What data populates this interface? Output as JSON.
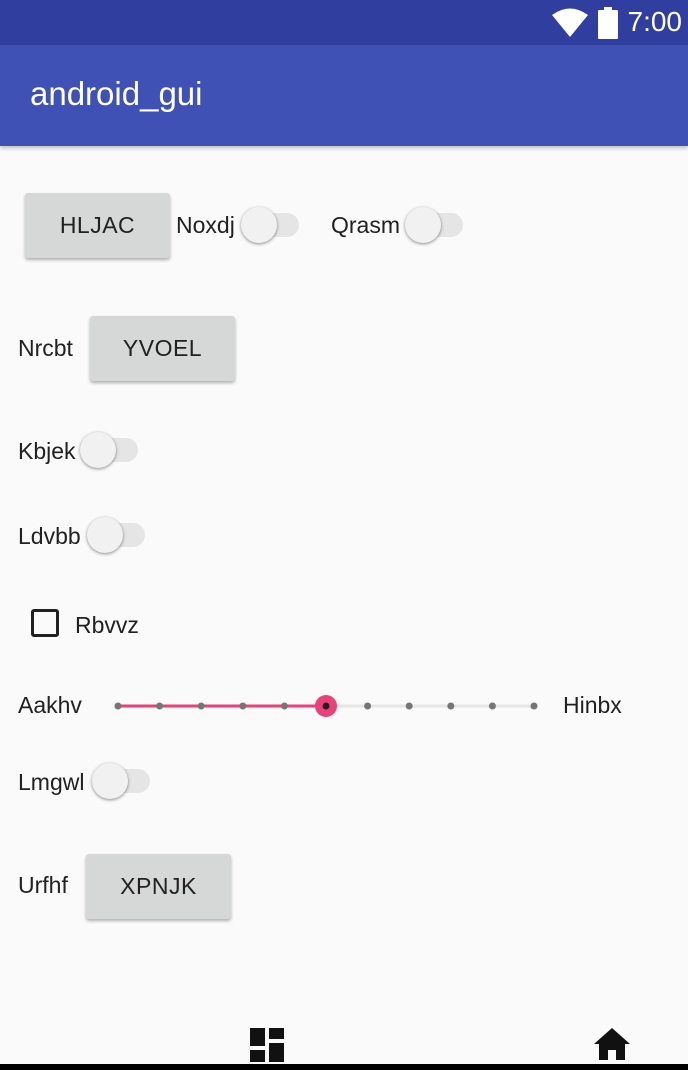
{
  "status_bar": {
    "time": "7:00",
    "wifi_icon": "wifi-icon",
    "battery_icon": "battery-icon"
  },
  "app_bar": {
    "title": "android_gui"
  },
  "controls": {
    "button_1": "HLJAC",
    "switch_1_label": "Noxdj",
    "switch_2_label": "Qrasm",
    "button_2_label": "Nrcbt",
    "button_2": "YVOEL",
    "switch_3_label": "Kbjek",
    "switch_4_label": "Ldvbb",
    "checkbox_label": "Rbvvz",
    "slider_min_label": "Aakhv",
    "slider_max_label": "Hinbx",
    "switch_5_label": "Lmgwl",
    "button_3_label": "Urfhf",
    "button_3": "XPNJK"
  },
  "state": {
    "switch_1_on": false,
    "switch_2_on": false,
    "switch_3_on": false,
    "switch_4_on": false,
    "switch_5_on": false,
    "checkbox_checked": false,
    "slider": {
      "steps": 10,
      "value": 5
    }
  },
  "colors": {
    "status_bar": "#303f9f",
    "app_bar": "#3f51b5",
    "accent": "#ec407a",
    "button": "#d6d7d7"
  },
  "nav_bar": {
    "left_icon": "dashboard-icon",
    "right_icon": "home-icon"
  }
}
